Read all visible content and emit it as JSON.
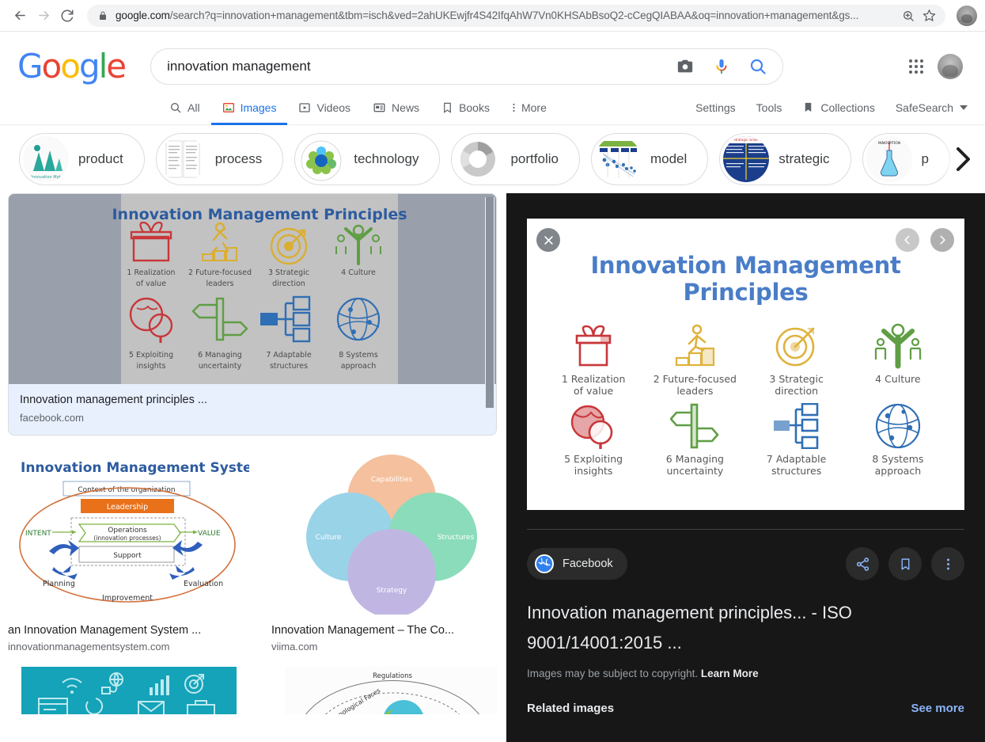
{
  "browser": {
    "back_icon": "back-arrow-icon",
    "forward_icon": "forward-arrow-icon",
    "reload_icon": "reload-icon",
    "lock_icon": "lock-icon",
    "url_host": "google.com",
    "url_path": "/search?q=innovation+management&tbm=isch&ved=2ahUKEwjfr4S42IfqAhW7Vn0KHSAbBsoQ2-cCegQIABAA&oq=innovation+management&gs...",
    "zoom_icon": "zoom-in-icon",
    "bookmark_icon": "star-icon",
    "profile_icon": "profile-avatar"
  },
  "header": {
    "logo_letters": [
      {
        "c": "G",
        "cls": "b"
      },
      {
        "c": "o",
        "cls": "r"
      },
      {
        "c": "o",
        "cls": "y"
      },
      {
        "c": "g",
        "cls": "b"
      },
      {
        "c": "l",
        "cls": "g"
      },
      {
        "c": "e",
        "cls": "r"
      }
    ],
    "search_value": "innovation management",
    "search_placeholder": "Search",
    "camera_icon": "camera-search-icon",
    "mic_icon": "microphone-icon",
    "search_icon": "search-icon",
    "apps_icon": "google-apps-grid-icon",
    "avatar_icon": "account-avatar"
  },
  "nav": {
    "tabs": [
      {
        "label": "All",
        "icon": "search-icon",
        "active": false
      },
      {
        "label": "Images",
        "icon": "image-icon",
        "active": true
      },
      {
        "label": "Videos",
        "icon": "video-icon",
        "active": false
      },
      {
        "label": "News",
        "icon": "news-icon",
        "active": false
      },
      {
        "label": "Books",
        "icon": "book-icon",
        "active": false
      },
      {
        "label": "More",
        "icon": "more-vertical-icon",
        "active": false
      }
    ],
    "right": [
      {
        "label": "Settings",
        "icon": ""
      },
      {
        "label": "Tools",
        "icon": ""
      },
      {
        "label": "Collections",
        "icon": "bookmark-icon"
      },
      {
        "label": "SafeSearch",
        "icon": "chevron-down-icon"
      }
    ]
  },
  "chips": {
    "items": [
      {
        "label": "product",
        "thumb": "teal-abstract-logo"
      },
      {
        "label": "process",
        "thumb": "two-column-document"
      },
      {
        "label": "technology",
        "thumb": "green-blue-cluster-diagram"
      },
      {
        "label": "portfolio",
        "thumb": "gray-donut-chart"
      },
      {
        "label": "model",
        "thumb": "blue-funnel-diagram"
      },
      {
        "label": "strategic",
        "thumb": "blue-matrix-slide"
      },
      {
        "label": "p",
        "thumb": "light-bulb-flask"
      }
    ],
    "next_icon": "chevron-right-icon"
  },
  "results": {
    "featured": {
      "title": "Innovation management principles ...",
      "source": "facebook.com",
      "image_heading": "Innovation Management Principles"
    },
    "grid": [
      {
        "title": "an Innovation Management System ...",
        "source": "innovationmanagementsystem.com",
        "image_heading": "Innovation Management System",
        "labels": [
          "Context of the organization",
          "Leadership",
          "Operations",
          "(innovation processes)",
          "Support",
          "INTENT",
          "VALUE",
          "Planning",
          "Evaluation",
          "Improvement"
        ]
      },
      {
        "title": "Innovation Management – The Co...",
        "source": "viima.com",
        "labels": [
          "Capabilities",
          "Culture",
          "Structures",
          "Strategy"
        ]
      }
    ],
    "row3": [
      {
        "thumb": "teal-digital-icons-banner"
      },
      {
        "thumb": "concentric-circles-diagram",
        "label": "Regulations"
      }
    ]
  },
  "preview": {
    "close_icon": "close-icon",
    "prev_icon": "chevron-left-icon",
    "next_icon": "chevron-right-icon",
    "image_heading": "Innovation Management Principles",
    "principles": [
      {
        "num": "1",
        "line1": "1 Realization",
        "line2": "of value",
        "icon": "gift-box-icon",
        "color": "#c8373a"
      },
      {
        "num": "2",
        "line1": "2 Future-focused",
        "line2": "leaders",
        "icon": "running-person-steps-icon",
        "color": "#e0b43a"
      },
      {
        "num": "3",
        "line1": "3 Strategic",
        "line2": "direction",
        "icon": "target-arrow-icon",
        "color": "#e0b43a"
      },
      {
        "num": "4",
        "line1": "4 Culture",
        "line2": "",
        "icon": "people-group-icon",
        "color": "#5f9e44"
      },
      {
        "num": "5",
        "line1": "5 Exploiting",
        "line2": "insights",
        "icon": "globe-magnifier-icon",
        "color": "#c8373a"
      },
      {
        "num": "6",
        "line1": "6 Managing",
        "line2": "uncertainty",
        "icon": "signpost-icon",
        "color": "#5f9e44"
      },
      {
        "num": "7",
        "line1": "7 Adaptable",
        "line2": "structures",
        "icon": "org-chart-icon",
        "color": "#2f6fb5"
      },
      {
        "num": "8",
        "line1": "8 Systems",
        "line2": "approach",
        "icon": "network-globe-icon",
        "color": "#2f6fb5"
      }
    ],
    "source_name": "Facebook",
    "source_favicon": "facebook-globe-icon",
    "share_icon": "share-icon",
    "save_icon": "bookmark-icon",
    "more_icon": "more-vertical-icon",
    "title": "Innovation management principles... - ISO 9001/14001:2015 ...",
    "copyright_text": "Images may be subject to copyright. ",
    "copyright_link": "Learn More",
    "related_label": "Related images",
    "see_more_label": "See more"
  },
  "colors": {
    "accent_blue": "#1a73e8",
    "link_blue": "#8ab4f8",
    "panel_bg": "#171717",
    "card_bg": "#e8f0fe"
  }
}
